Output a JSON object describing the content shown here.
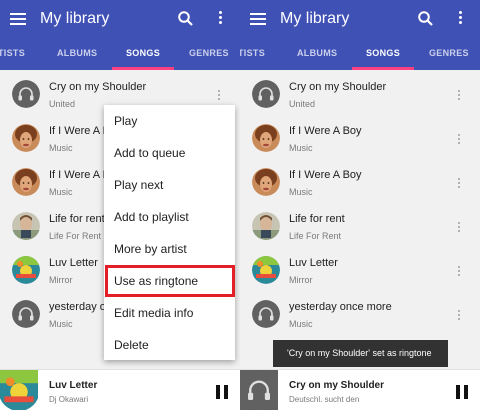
{
  "left": {
    "title": "My library",
    "tabs": [
      "TISTS",
      "ALBUMS",
      "SONGS",
      "GENRES"
    ],
    "active_tab": "SONGS",
    "songs": [
      {
        "title": "Cry on my Shoulder",
        "subtitle": "United",
        "art": "headphones-placeholder"
      },
      {
        "title": "If I Were A B",
        "subtitle": "Music",
        "art": "beyonce-cover"
      },
      {
        "title": "If I Were A B",
        "subtitle": "Music",
        "art": "beyonce-cover"
      },
      {
        "title": "Life for rent",
        "subtitle": "Life For Rent",
        "art": "life-for-rent-cover"
      },
      {
        "title": "Luv Letter",
        "subtitle": "Mirror",
        "art": "luv-letter-cover"
      },
      {
        "title": "yesterday o",
        "subtitle": "Music",
        "art": "headphones-placeholder"
      }
    ],
    "menu": [
      "Play",
      "Add to queue",
      "Play next",
      "Add to playlist",
      "More by artist",
      "Use as ringtone",
      "Edit media info",
      "Delete"
    ],
    "highlighted_menu_item": "Use as ringtone",
    "now_playing": {
      "title": "Luv Letter",
      "subtitle": "Dj Okawari",
      "art": "luv-letter-cover"
    }
  },
  "right": {
    "title": "My library",
    "tabs": [
      "TISTS",
      "ALBUMS",
      "SONGS",
      "GENRES"
    ],
    "active_tab": "SONGS",
    "songs": [
      {
        "title": "Cry on my Shoulder",
        "subtitle": "United",
        "art": "headphones-placeholder"
      },
      {
        "title": "If I Were A Boy",
        "subtitle": "Music",
        "art": "beyonce-cover"
      },
      {
        "title": "If I Were A Boy",
        "subtitle": "Music",
        "art": "beyonce-cover"
      },
      {
        "title": "Life for rent",
        "subtitle": "Life For Rent",
        "art": "life-for-rent-cover"
      },
      {
        "title": "Luv Letter",
        "subtitle": "Mirror",
        "art": "luv-letter-cover"
      },
      {
        "title": "yesterday once more",
        "subtitle": "Music",
        "art": "headphones-placeholder"
      }
    ],
    "toast": "'Cry on my Shoulder' set as ringtone",
    "now_playing": {
      "title": "Cry on my Shoulder",
      "subtitle": "Deutschl. sucht den",
      "art": "headphones-placeholder"
    }
  },
  "colors": {
    "appbar": "#3f51b5",
    "tab_indicator": "#ff4081",
    "highlight_border": "#e41e26",
    "toast_bg": "#323232"
  }
}
